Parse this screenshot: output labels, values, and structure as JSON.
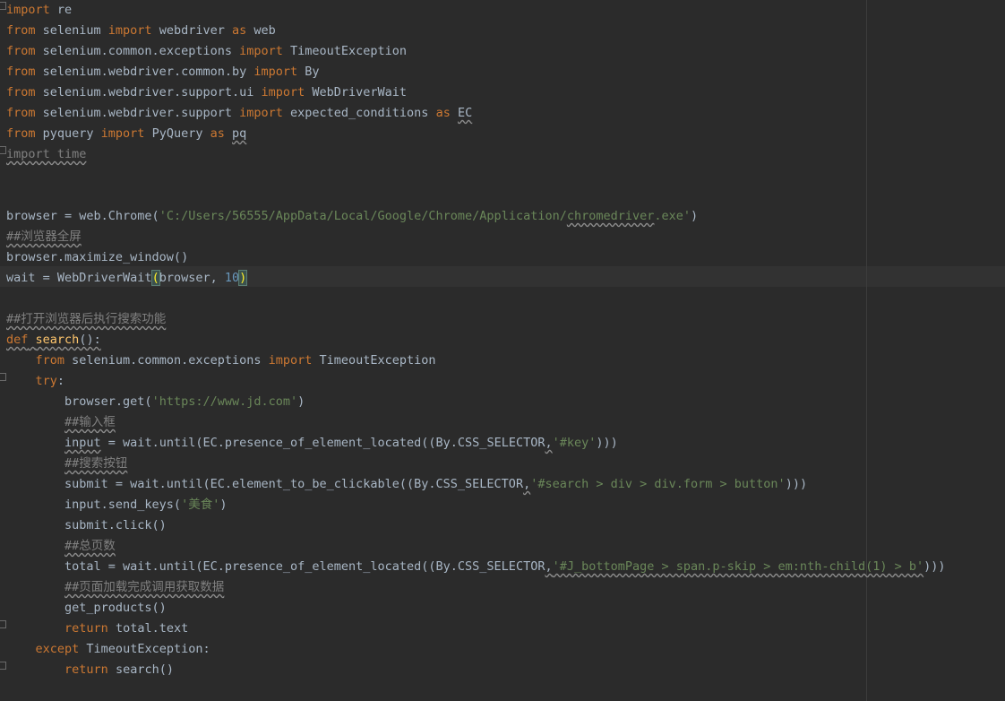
{
  "lines": [
    [
      {
        "t": "import",
        "c": "kw"
      },
      {
        "t": " re"
      }
    ],
    [
      {
        "t": "from",
        "c": "kw"
      },
      {
        "t": " selenium "
      },
      {
        "t": "import",
        "c": "kw"
      },
      {
        "t": " webdriver "
      },
      {
        "t": "as",
        "c": "kw"
      },
      {
        "t": " web"
      }
    ],
    [
      {
        "t": "from",
        "c": "kw"
      },
      {
        "t": " selenium.common.exceptions "
      },
      {
        "t": "import",
        "c": "kw"
      },
      {
        "t": " TimeoutException"
      }
    ],
    [
      {
        "t": "from",
        "c": "kw"
      },
      {
        "t": " selenium.webdriver.common.by "
      },
      {
        "t": "import",
        "c": "kw"
      },
      {
        "t": " By"
      }
    ],
    [
      {
        "t": "from",
        "c": "kw"
      },
      {
        "t": " selenium.webdriver.support.ui "
      },
      {
        "t": "import",
        "c": "kw"
      },
      {
        "t": " WebDriverWait"
      }
    ],
    [
      {
        "t": "from",
        "c": "kw"
      },
      {
        "t": " selenium.webdriver.support "
      },
      {
        "t": "import",
        "c": "kw"
      },
      {
        "t": " expected_conditions "
      },
      {
        "t": "as",
        "c": "kw"
      },
      {
        "t": " "
      },
      {
        "t": "EC",
        "w": 1
      }
    ],
    [
      {
        "t": "from",
        "c": "kw"
      },
      {
        "t": " pyquery "
      },
      {
        "t": "import",
        "c": "kw"
      },
      {
        "t": " PyQuery "
      },
      {
        "t": "as",
        "c": "kw"
      },
      {
        "t": " "
      },
      {
        "t": "pq",
        "w": 1
      }
    ],
    [
      {
        "t": "import time",
        "c": "cm",
        "w": 1
      }
    ],
    [],
    [],
    [
      {
        "t": "browser = web.Chrome("
      },
      {
        "t": "'C:/Users/56555/AppData/Local/Google/Chrome/Application/",
        "c": "str"
      },
      {
        "t": "chromedriver",
        "c": "str",
        "w": 1
      },
      {
        "t": ".exe'",
        "c": "str"
      },
      {
        "t": ")"
      }
    ],
    [
      {
        "t": "##浏览器全屏",
        "c": "cm",
        "w": 1
      }
    ],
    [
      {
        "t": "browser.maximize_window()"
      }
    ],
    [
      {
        "t": "wait = WebDriverWait"
      },
      {
        "t": "(",
        "m": 1
      },
      {
        "t": "browser, "
      },
      {
        "t": "10",
        "c": "num"
      },
      {
        "t": ")",
        "m": 1
      }
    ],
    [],
    [
      {
        "t": "##打开浏览器后执行搜索功能",
        "c": "cm",
        "w": 1
      }
    ],
    [
      {
        "t": "def",
        "c": "kw",
        "w": 1
      },
      {
        "t": " ",
        "w": 1
      },
      {
        "t": "search",
        "c": "fn",
        "w": 1
      },
      {
        "t": "():",
        "w": 1
      }
    ],
    [
      {
        "t": "    "
      },
      {
        "t": "from",
        "c": "kw"
      },
      {
        "t": " selenium.common.exceptions "
      },
      {
        "t": "import",
        "c": "kw"
      },
      {
        "t": " TimeoutException"
      }
    ],
    [
      {
        "t": "    "
      },
      {
        "t": "try",
        "c": "kw"
      },
      {
        "t": ":"
      }
    ],
    [
      {
        "t": "        browser.get("
      },
      {
        "t": "'https://www.jd.com'",
        "c": "str"
      },
      {
        "t": ")"
      }
    ],
    [
      {
        "t": "        "
      },
      {
        "t": "##输入框",
        "c": "cm",
        "w": 1
      }
    ],
    [
      {
        "t": "        "
      },
      {
        "t": "input",
        "w": 1
      },
      {
        "t": " = wait.until(EC.presence_of_element_located((By.CSS_SELECTOR"
      },
      {
        "t": ",",
        "w": 1
      },
      {
        "t": "'#key'",
        "c": "str"
      },
      {
        "t": ")))"
      }
    ],
    [
      {
        "t": "        "
      },
      {
        "t": "##搜索按钮",
        "c": "cm",
        "w": 1
      }
    ],
    [
      {
        "t": "        submit = wait.until(EC.element_to_be_clickable((By.CSS_SELECTOR"
      },
      {
        "t": ",",
        "w": 1
      },
      {
        "t": "'#search > div > div.form > button'",
        "c": "str"
      },
      {
        "t": ")))"
      }
    ],
    [
      {
        "t": "        input.send_keys("
      },
      {
        "t": "'美食'",
        "c": "str"
      },
      {
        "t": ")"
      }
    ],
    [
      {
        "t": "        submit.click()"
      }
    ],
    [
      {
        "t": "        "
      },
      {
        "t": "##总页数",
        "c": "cm",
        "w": 1
      }
    ],
    [
      {
        "t": "        total = wait.until(EC.presence_of_element_located((By.CSS_SELECTOR"
      },
      {
        "t": ",",
        "w": 1
      },
      {
        "t": "'#J_bottomPage > span.p-skip > em:nth-child(1) > b'",
        "c": "str",
        "w": 1
      },
      {
        "t": ")))"
      }
    ],
    [
      {
        "t": "        "
      },
      {
        "t": "##页面加载完成调用获取数据",
        "c": "cm",
        "w": 1
      }
    ],
    [
      {
        "t": "        get_products()"
      }
    ],
    [
      {
        "t": "        "
      },
      {
        "t": "return",
        "c": "kw"
      },
      {
        "t": " total.text"
      }
    ],
    [
      {
        "t": "    "
      },
      {
        "t": "except",
        "c": "kw"
      },
      {
        "t": " TimeoutException:"
      }
    ],
    [
      {
        "t": "        "
      },
      {
        "t": "return",
        "c": "kw"
      },
      {
        "t": " search()"
      }
    ]
  ],
  "fold_marker_lines": [
    0,
    7,
    18,
    30,
    32
  ]
}
